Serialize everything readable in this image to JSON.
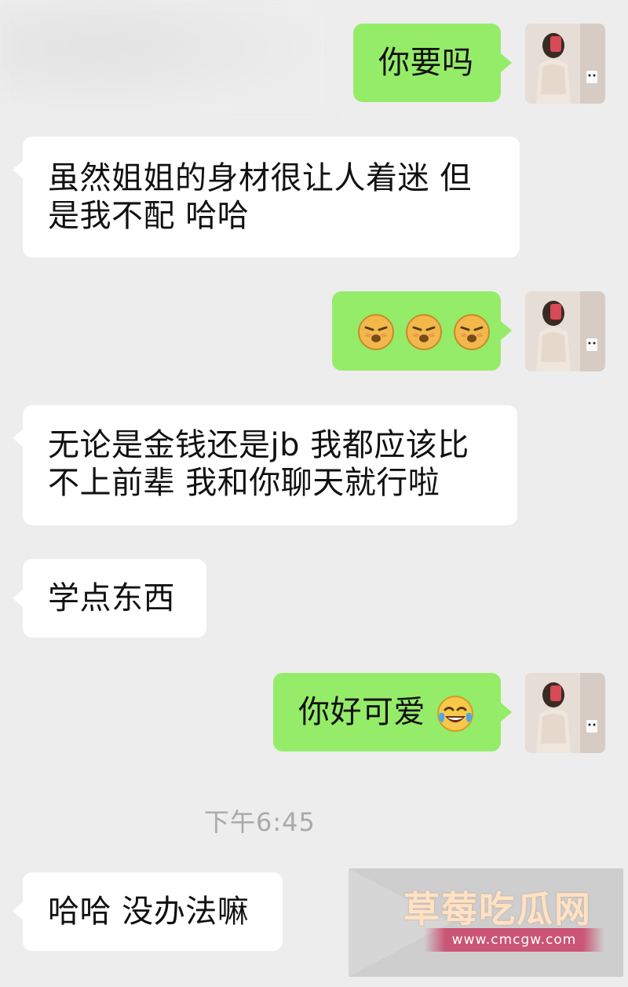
{
  "chat": {
    "messages": [
      {
        "side": "out",
        "text": "你要吗"
      },
      {
        "side": "in",
        "lines": [
          "虽然姐姐的身材很让人着迷 但",
          "是我不配 哈哈"
        ]
      },
      {
        "side": "out",
        "emoji": [
          "pouting-kiss-emoji",
          "pouting-kiss-emoji",
          "pouting-kiss-emoji"
        ]
      },
      {
        "side": "in",
        "lines": [
          "无论是金钱还是jb 我都应该比",
          "不上前辈 我和你聊天就行啦"
        ]
      },
      {
        "side": "in",
        "text": "学点东西"
      },
      {
        "side": "out",
        "text": "你好可爱",
        "trailing_emoji": "tears-of-joy-emoji"
      },
      {
        "side": "in",
        "text": "哈哈 没办法嘛"
      }
    ],
    "timestamp": "下午6:45"
  },
  "watermark": {
    "title": "草莓吃瓜网",
    "url": "www.cmcgw.com"
  },
  "colors": {
    "background": "#ededed",
    "incoming_bubble": "#ffffff",
    "outgoing_bubble": "#95ec69",
    "timestamp_text": "#a9a9a9"
  }
}
